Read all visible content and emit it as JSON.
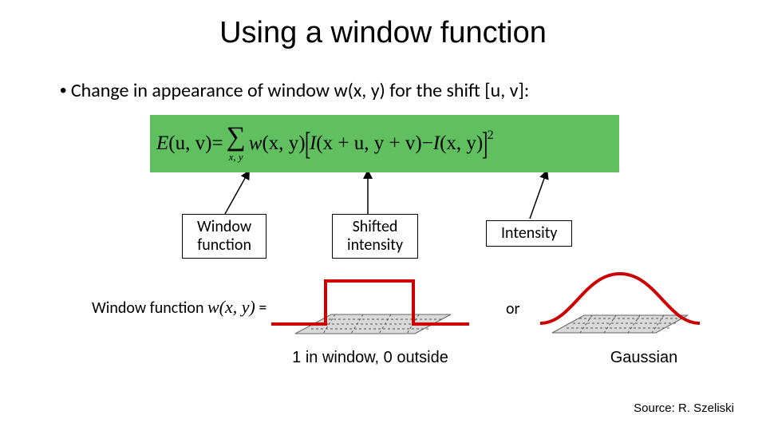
{
  "title": "Using a window function",
  "bullet": {
    "marker": "•",
    "text": "Change in appearance of window w(x, y)  for the shift [u, v]:"
  },
  "equation": {
    "lhs_E": "E",
    "lhs_args": "(u, v)",
    "eq": " = ",
    "sigma": "∑",
    "sigma_sub": "x, y",
    "w": "w",
    "w_args": "(x, y)",
    "lbrack": "[",
    "I1": "I",
    "I1_args": "(x + u, y + v)",
    "minus": " − ",
    "I2": "I",
    "I2_args": "(x, y)",
    "rbrack": "]",
    "sq": "2"
  },
  "callouts": {
    "window_l1": "Window",
    "window_l2": "function",
    "shifted_l1": "Shifted",
    "shifted_l2": "intensity",
    "intensity": "Intensity"
  },
  "wf_row": {
    "label_text": "Window function ",
    "wxy": "w(x, y)",
    "equals": " =",
    "or": "or",
    "cap_box": "1 in window, 0 outside",
    "cap_gauss": "Gaussian"
  },
  "source": "Source: R. Szeliski",
  "colors": {
    "green_bar": "#60c060",
    "red": "#cc0000"
  }
}
